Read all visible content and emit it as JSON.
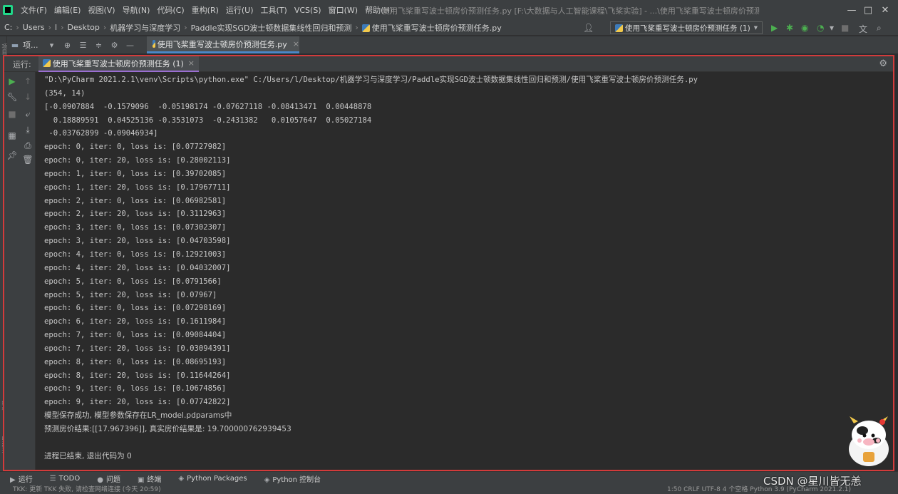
{
  "menu": {
    "items": [
      "文件(F)",
      "编辑(E)",
      "视图(V)",
      "导航(N)",
      "代码(C)",
      "重构(R)",
      "运行(U)",
      "工具(T)",
      "VCS(S)",
      "窗口(W)",
      "帮助(H)"
    ],
    "window_title": "使用飞桨重写波士顿房价预测任务.py [F:\\大数据与人工智能课程\\飞桨实验] - ...\\使用飞桨重写波士顿房价预测任务.py"
  },
  "breadcrumb": {
    "items": [
      "C:",
      "Users",
      "l",
      "Desktop",
      "机器学习与深度学习",
      "Paddle实现SGD波士顿数据集线性回归和预测",
      "使用飞桨重写波士顿房价预测任务.py"
    ]
  },
  "run_config": {
    "label": "使用飞桨重写波士顿房价预测任务 (1)"
  },
  "toolbar": {
    "project_label": "项..."
  },
  "editor_tab": {
    "label": "使用飞桨重写波士顿房价预测任务.py"
  },
  "run_panel": {
    "label": "运行:",
    "tab_label": "使用飞桨重写波士顿房价预测任务 (1)"
  },
  "console": {
    "lines": [
      "\"D:\\PyCharm 2021.2.1\\venv\\Scripts\\python.exe\" C:/Users/l/Desktop/机器学习与深度学习/Paddle实现SGD波士顿数据集线性回归和预测/使用飞桨重写波士顿房价预测任务.py",
      "(354, 14)",
      "[-0.0907884  -0.1579096  -0.05198174 -0.07627118 -0.08413471  0.00448878",
      "  0.18889591  0.04525136 -0.3531073  -0.2431382   0.01057647  0.05027184",
      " -0.03762899 -0.09046934]",
      "epoch: 0, iter: 0, loss is: [0.07727982]",
      "epoch: 0, iter: 20, loss is: [0.28002113]",
      "epoch: 1, iter: 0, loss is: [0.39702085]",
      "epoch: 1, iter: 20, loss is: [0.17967711]",
      "epoch: 2, iter: 0, loss is: [0.06982581]",
      "epoch: 2, iter: 20, loss is: [0.3112963]",
      "epoch: 3, iter: 0, loss is: [0.07302307]",
      "epoch: 3, iter: 20, loss is: [0.04703598]",
      "epoch: 4, iter: 0, loss is: [0.12921003]",
      "epoch: 4, iter: 20, loss is: [0.04032007]",
      "epoch: 5, iter: 0, loss is: [0.0791566]",
      "epoch: 5, iter: 20, loss is: [0.07967]",
      "epoch: 6, iter: 0, loss is: [0.07298169]",
      "epoch: 6, iter: 20, loss is: [0.1611984]",
      "epoch: 7, iter: 0, loss is: [0.09084404]",
      "epoch: 7, iter: 20, loss is: [0.03094391]",
      "epoch: 8, iter: 0, loss is: [0.08695193]",
      "epoch: 8, iter: 20, loss is: [0.11644264]",
      "epoch: 9, iter: 0, loss is: [0.10674856]",
      "epoch: 9, iter: 20, loss is: [0.07742822]",
      "模型保存成功, 模型参数保存在LR_model.pdparams中",
      "预测房价结果:[[17.967396]], 真实房价结果是: 19.700000762939453",
      "",
      "进程已结束, 退出代码为 0"
    ]
  },
  "bottom_tools": {
    "items": [
      {
        "icon": "play-icon",
        "label": "运行"
      },
      {
        "icon": "todo-icon",
        "label": "TODO"
      },
      {
        "icon": "problems-icon",
        "label": "问题"
      },
      {
        "icon": "terminal-icon",
        "label": "终端"
      },
      {
        "icon": "python-packages-icon",
        "label": "Python Packages"
      },
      {
        "icon": "python-console-icon",
        "label": "Python 控制台"
      }
    ]
  },
  "status": {
    "left": "TKK: 更新 TKK 失败, 请检查网络连接 (今天 20:59)",
    "right": "1:50   CRLF   UTF-8   4 个空格   Python 3.9 (PyCharm 2021.2.1)"
  },
  "sidebar_labels": {
    "project": "项目",
    "structure": "结构",
    "bookmarks": "收藏夹"
  },
  "watermark": "CSDN @星川皆无恙",
  "colors": {
    "background": "#2b2b2b",
    "panel": "#3c3f41",
    "highlight_border": "#d33b3b",
    "run_green": "#4caf50"
  }
}
